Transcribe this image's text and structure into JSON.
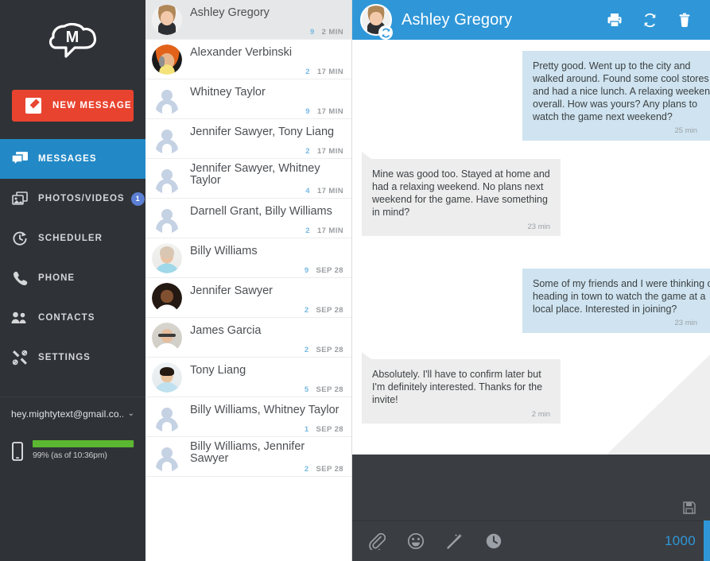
{
  "sidebar": {
    "logo_name": "mightytext-cloud-logo",
    "logo_letter": "M",
    "new_message_label": "NEW MESSAGE",
    "accent_red": "#e8432f",
    "accent_blue": "#2289c6",
    "nav": [
      {
        "label": "MESSAGES",
        "icon": "messages-icon",
        "active": true,
        "badge": ""
      },
      {
        "label": "PHOTOS/VIDEOS",
        "icon": "photos-icon",
        "active": false,
        "badge": "1"
      },
      {
        "label": "SCHEDULER",
        "icon": "scheduler-icon",
        "active": false,
        "badge": ""
      },
      {
        "label": "PHONE",
        "icon": "phone-icon",
        "active": false,
        "badge": ""
      },
      {
        "label": "CONTACTS",
        "icon": "contacts-icon",
        "active": false,
        "badge": ""
      },
      {
        "label": "SETTINGS",
        "icon": "settings-icon",
        "active": false,
        "badge": ""
      }
    ],
    "account": {
      "email": "hey.mightytext@gmail.co...",
      "caret": "⌄"
    },
    "battery": {
      "percent": 99,
      "text": "99% (as of 10:36pm)",
      "bar_color": "#5bb731"
    }
  },
  "conversations": [
    {
      "name": "Ashley Gregory",
      "count": "9",
      "time": "2 MIN",
      "avatar": "photo-ashley",
      "selected": true,
      "lines": 1
    },
    {
      "name": "Alexander Verbinski",
      "count": "2",
      "time": "17 MIN",
      "avatar": "photo-alexander",
      "selected": false,
      "lines": 1
    },
    {
      "name": "Whitney Taylor",
      "count": "9",
      "time": "17 MIN",
      "avatar": "silhouette",
      "selected": false,
      "lines": 1
    },
    {
      "name": "Jennifer Sawyer, Tony Liang",
      "count": "2",
      "time": "17 MIN",
      "avatar": "silhouette",
      "selected": false,
      "lines": 1
    },
    {
      "name": "Jennifer Sawyer, Whitney Taylor",
      "count": "4",
      "time": "17 MIN",
      "avatar": "silhouette",
      "selected": false,
      "lines": 2
    },
    {
      "name": "Darnell Grant, Billy Williams",
      "count": "2",
      "time": "17 MIN",
      "avatar": "silhouette",
      "selected": false,
      "lines": 1
    },
    {
      "name": "Billy Williams",
      "count": "9",
      "time": "SEP 28",
      "avatar": "photo-billy",
      "selected": false,
      "lines": 1
    },
    {
      "name": "Jennifer Sawyer",
      "count": "2",
      "time": "SEP 28",
      "avatar": "photo-jennifer",
      "selected": false,
      "lines": 1
    },
    {
      "name": "James Garcia",
      "count": "2",
      "time": "SEP 28",
      "avatar": "photo-james",
      "selected": false,
      "lines": 1
    },
    {
      "name": "Tony Liang",
      "count": "5",
      "time": "SEP 28",
      "avatar": "photo-tony",
      "selected": false,
      "lines": 1
    },
    {
      "name": "Billy Williams, Whitney Taylor",
      "count": "1",
      "time": "SEP 28",
      "avatar": "silhouette",
      "selected": false,
      "lines": 1
    },
    {
      "name": "Billy Williams, Jennifer Sawyer",
      "count": "2",
      "time": "SEP 28",
      "avatar": "silhouette",
      "selected": false,
      "lines": 2
    }
  ],
  "chat": {
    "header": {
      "contact_name": "Ashley Gregory",
      "avatar": "photo-ashley",
      "sync_badge_icon": "sync-icon",
      "actions": [
        {
          "icon": "print-icon",
          "name": "print-button"
        },
        {
          "icon": "refresh-icon",
          "name": "refresh-button"
        },
        {
          "icon": "trash-icon",
          "name": "delete-button"
        }
      ],
      "bg_color": "#2f97d8"
    },
    "messages": [
      {
        "direction": "outgoing",
        "text": "Pretty good. Went up to the city and walked around. Found some cool stores and had a nice lunch. A relaxing weekend overall. How was yours? Any plans to watch the game next weekend?",
        "time": "25 min",
        "status_icon": "delivered-icon"
      },
      {
        "direction": "incoming",
        "text": "Mine was good too. Stayed at home and had a relaxing weekend. No plans next weekend for the game. Have something in mind?",
        "time": "23 min",
        "status_icon": ""
      },
      {
        "direction": "outgoing",
        "text": "Some of my friends and I were thinking of heading in town to watch the game at a local place. Interested in joining?",
        "time": "23 min",
        "status_icon": "delivered-icon"
      },
      {
        "direction": "incoming",
        "text": "Absolutely. I'll have to confirm later but I'm definitely interested. Thanks for the invite!",
        "time": "2 min",
        "status_icon": ""
      }
    ],
    "composer": {
      "message_value": "",
      "placeholder": "",
      "save_icon": "save-draft-icon",
      "tools": [
        {
          "icon": "attachment-icon",
          "name": "attach-button"
        },
        {
          "icon": "emoji-icon",
          "name": "emoji-button"
        },
        {
          "icon": "magic-wand-icon",
          "name": "templates-button"
        },
        {
          "icon": "clock-icon",
          "name": "schedule-button"
        }
      ],
      "char_count": "1000",
      "char_count_color": "#2f97d8"
    }
  }
}
